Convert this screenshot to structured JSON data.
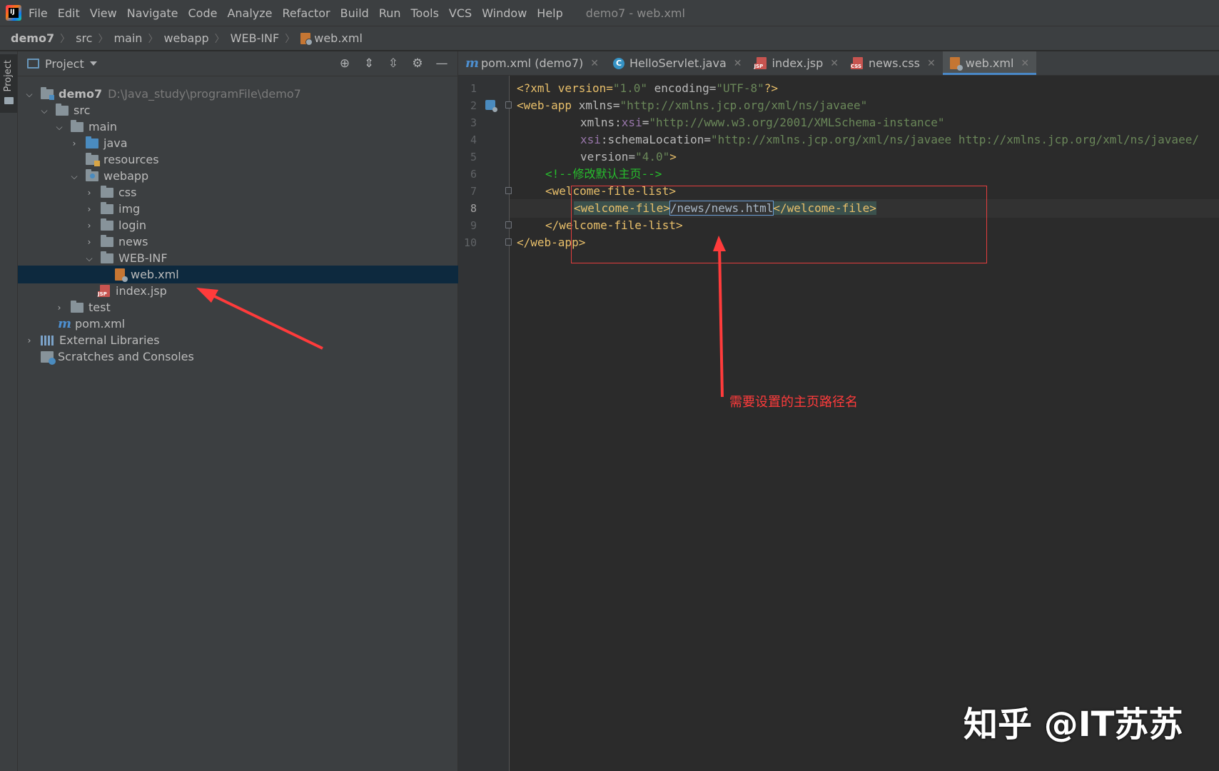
{
  "menubar": {
    "items": [
      "File",
      "Edit",
      "View",
      "Navigate",
      "Code",
      "Analyze",
      "Refactor",
      "Build",
      "Run",
      "Tools",
      "VCS",
      "Window",
      "Help"
    ],
    "window_title": "demo7 - web.xml"
  },
  "breadcrumb": [
    "demo7",
    "src",
    "main",
    "webapp",
    "WEB-INF",
    "web.xml"
  ],
  "left_stripe": {
    "label": "Project"
  },
  "project_panel": {
    "title": "Project",
    "tree": [
      {
        "label": "demo7",
        "path": "D:\\Java_study\\programFile\\demo7"
      },
      {
        "label": "src"
      },
      {
        "label": "main"
      },
      {
        "label": "java"
      },
      {
        "label": "resources"
      },
      {
        "label": "webapp"
      },
      {
        "label": "css"
      },
      {
        "label": "img"
      },
      {
        "label": "login"
      },
      {
        "label": "news"
      },
      {
        "label": "WEB-INF"
      },
      {
        "label": "web.xml"
      },
      {
        "label": "index.jsp"
      },
      {
        "label": "test"
      },
      {
        "label": "pom.xml"
      },
      {
        "label": "External Libraries"
      },
      {
        "label": "Scratches and Consoles"
      }
    ]
  },
  "tabs": [
    {
      "label": "pom.xml (demo7)",
      "icon": "maven-icon"
    },
    {
      "label": "HelloServlet.java",
      "icon": "java-class-icon"
    },
    {
      "label": "index.jsp",
      "icon": "jsp-file-icon"
    },
    {
      "label": "news.css",
      "icon": "css-file-icon"
    },
    {
      "label": "web.xml",
      "icon": "xml-file-icon",
      "active": true
    }
  ],
  "editor": {
    "line_numbers": [
      "1",
      "2",
      "3",
      "4",
      "5",
      "6",
      "7",
      "8",
      "9",
      "10"
    ],
    "current_line": 8,
    "code": {
      "l1_decl_start": "<?xml version=",
      "l1_v1": "\"1.0\"",
      "l1_mid": " encoding=",
      "l1_v2": "\"UTF-8\"",
      "l1_end": "?>",
      "l2_tag": "<web-app",
      "l2_attr": " xmlns=",
      "l2_val": "\"http://xmlns.jcp.org/xml/ns/javaee\"",
      "l3_attr": "xmlns:",
      "l3_ns": "xsi",
      "l3_eq": "=",
      "l3_val": "\"http://www.w3.org/2001/XMLSchema-instance\"",
      "l4_ns": "xsi",
      "l4_attr": ":schemaLocation=",
      "l4_val": "\"http://xmlns.jcp.org/xml/ns/javaee http://xmlns.jcp.org/xml/ns/javaee/",
      "l5_attr": "version=",
      "l5_val": "\"4.0\"",
      "l5_end": ">",
      "l6_comment": "<!--修改默认主页-->",
      "l7_tag": "<welcome-file-list>",
      "l8_open": "<welcome-file>",
      "l8_text": "/news/news.html",
      "l8_close": "</welcome-file>",
      "l9_tag": "</welcome-file-list>",
      "l10_tag": "</web-app>"
    }
  },
  "annotation": {
    "text": "需要设置的主页路径名",
    "color": "#ff3b3b"
  },
  "watermark": "知乎 @IT苏苏"
}
